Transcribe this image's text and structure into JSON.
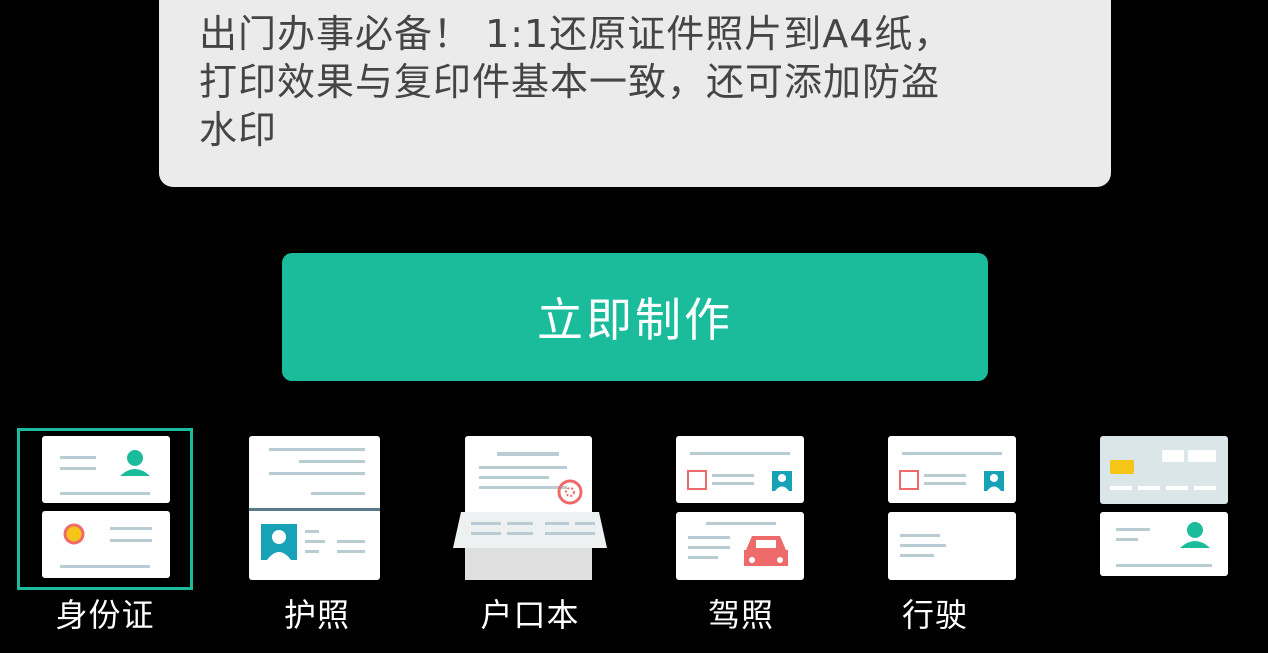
{
  "description": {
    "text": "出门办事必备！ 1:1还原证件照片到A4纸，\n打印效果与复印件基本一致，还可添加防盗\n水印"
  },
  "action_button": {
    "label": "立即制作"
  },
  "doc_types": [
    {
      "label": "身份证",
      "icon": "id-card-icon",
      "selected": true
    },
    {
      "label": "护照",
      "icon": "passport-icon",
      "selected": false
    },
    {
      "label": "户口本",
      "icon": "household-register-icon",
      "selected": false
    },
    {
      "label": "驾照",
      "icon": "driver-license-icon",
      "selected": false
    },
    {
      "label": "行驶",
      "icon": "vehicle-license-icon",
      "selected": false
    },
    {
      "label": "",
      "icon": "bank-card-icon",
      "selected": false
    }
  ],
  "colors": {
    "accent": "#1bbc9c",
    "card_bg": "#ebebeb",
    "background": "#000000",
    "icon_line": "#b9ccd4",
    "icon_red": "#ef6b6b",
    "icon_teal": "#17a2b8",
    "chip_yellow": "#f5c518"
  }
}
